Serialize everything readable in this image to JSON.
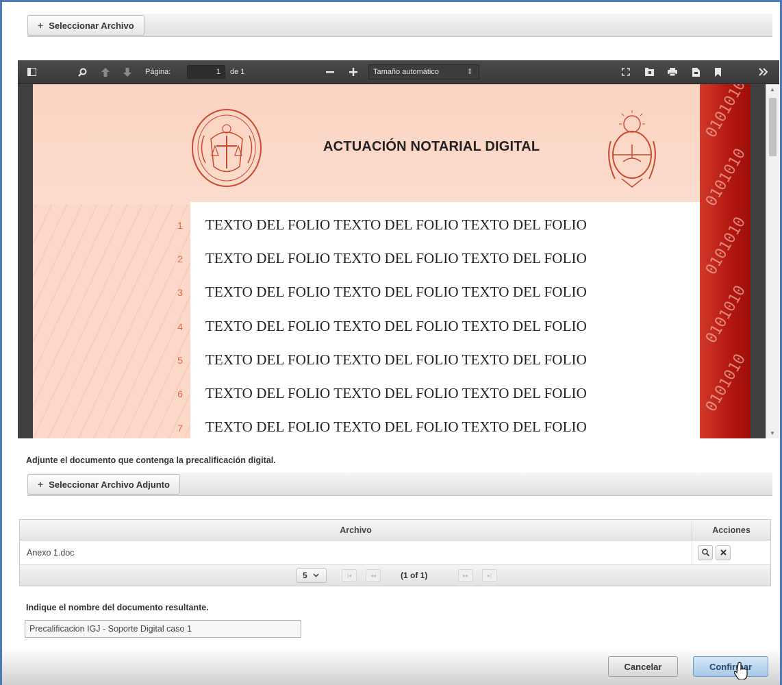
{
  "upload": {
    "select_file_label": "Seleccionar Archivo",
    "icon": "plus-icon"
  },
  "viewer": {
    "toolbar": {
      "page_label": "Página:",
      "page_value": "1",
      "page_of": "de 1",
      "zoom_label": "Tamaño automático",
      "zoom_caret": "⇕",
      "icons": [
        "sidebar-toggle-icon",
        "search-icon",
        "previous-page-icon",
        "next-page-icon",
        "zoom-out-icon",
        "zoom-in-icon",
        "presentation-mode-icon",
        "open-file-icon",
        "print-icon",
        "download-icon",
        "bookmark-icon",
        "tools-icon"
      ]
    },
    "document": {
      "title": "ACTUACIÓN NOTARIAL DIGITAL",
      "lines": [
        {
          "number": "1",
          "text": "TEXTO DEL FOLIO TEXTO DEL FOLIO TEXTO DEL FOLIO"
        },
        {
          "number": "2",
          "text": "TEXTO DEL FOLIO TEXTO DEL FOLIO TEXTO DEL FOLIO"
        },
        {
          "number": "3",
          "text": "TEXTO DEL FOLIO TEXTO DEL FOLIO TEXTO DEL FOLIO"
        },
        {
          "number": "4",
          "text": "TEXTO DEL FOLIO TEXTO DEL FOLIO TEXTO DEL FOLIO"
        },
        {
          "number": "5",
          "text": "TEXTO DEL FOLIO TEXTO DEL FOLIO TEXTO DEL FOLIO"
        },
        {
          "number": "6",
          "text": "TEXTO DEL FOLIO TEXTO DEL FOLIO TEXTO DEL FOLIO"
        },
        {
          "number": "7",
          "text": "TEXTO DEL FOLIO TEXTO DEL FOLIO TEXTO DEL FOLIO"
        }
      ],
      "band_text": "0101010"
    }
  },
  "attach": {
    "instruction": "Adjunte el documento que contenga la precalificación digital.",
    "select_attachment_label": "Seleccionar Archivo Adjunto"
  },
  "table": {
    "columns": [
      "Archivo",
      "Acciones"
    ],
    "rows": [
      {
        "file": "Anexo 1.doc"
      }
    ],
    "paginator": {
      "rows_per_page": "5",
      "current": "(1 of 1)"
    }
  },
  "result": {
    "label": "Indique el nombre del documento resultante.",
    "name_value": "Precalificacion IGJ - Soporte Digital caso 1"
  },
  "actions": {
    "cancel_label": "Cancelar",
    "confirm_label": "Confirmar"
  },
  "colors": {
    "accent_border": "#4a79b8",
    "page_pink": "#fbd8c8",
    "band_red": "#b2160f",
    "confirm_bg": "#a9c9e8"
  }
}
